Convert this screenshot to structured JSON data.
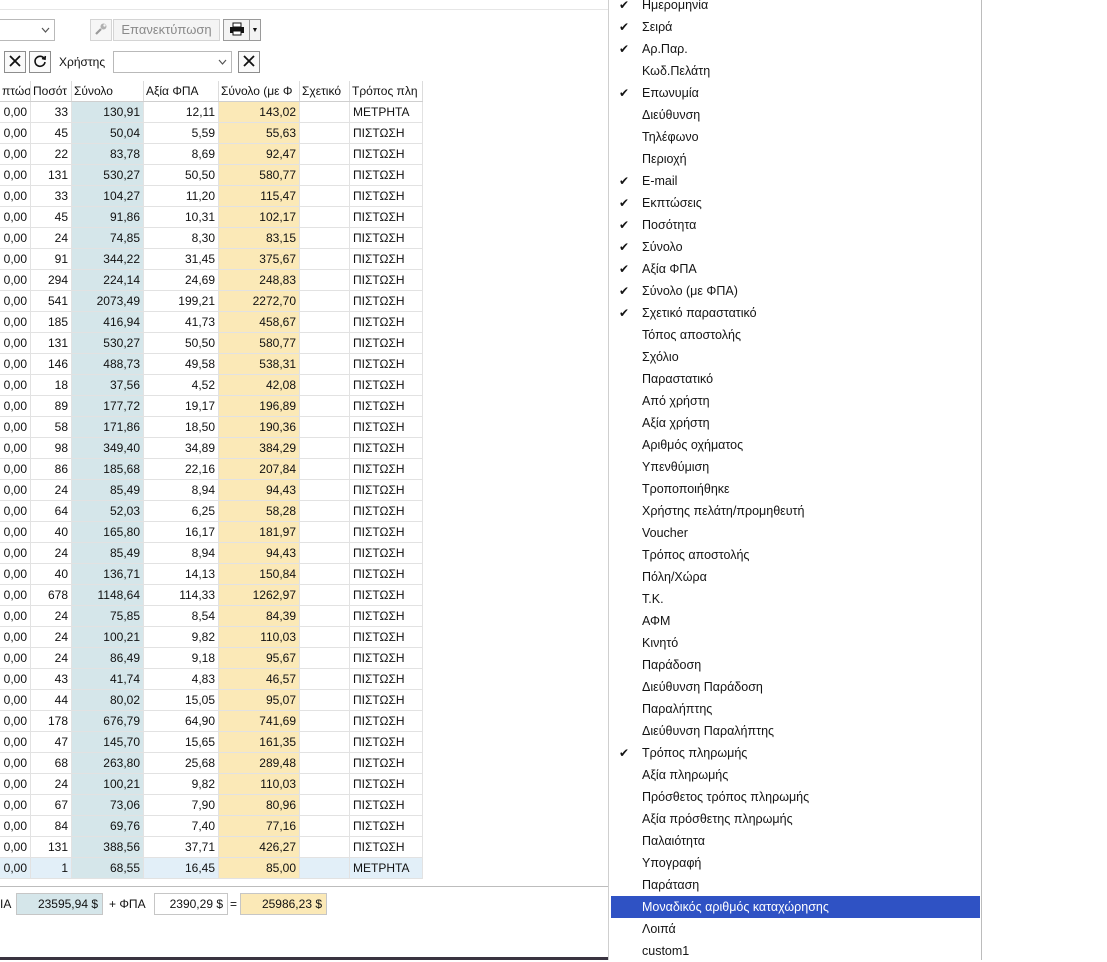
{
  "toolbar": {
    "reprint_label": "Επανεκτύπωση",
    "user_label": "Χρήστης",
    "user_value": ""
  },
  "grid": {
    "columns": [
      "πτώσ",
      "Ποσότ",
      "Σύνολο",
      "Αξία ΦΠΑ",
      "Σύνολο (με Φ",
      "Σχετικό",
      "Τρόπος πλη"
    ],
    "rows": [
      [
        "0,00",
        "33",
        "130,91",
        "12,11",
        "143,02",
        "",
        "ΜΕΤΡΗΤΑ"
      ],
      [
        "0,00",
        "45",
        "50,04",
        "5,59",
        "55,63",
        "",
        "ΠΙΣΤΩΣΗ"
      ],
      [
        "0,00",
        "22",
        "83,78",
        "8,69",
        "92,47",
        "",
        "ΠΙΣΤΩΣΗ"
      ],
      [
        "0,00",
        "131",
        "530,27",
        "50,50",
        "580,77",
        "",
        "ΠΙΣΤΩΣΗ"
      ],
      [
        "0,00",
        "33",
        "104,27",
        "11,20",
        "115,47",
        "",
        "ΠΙΣΤΩΣΗ"
      ],
      [
        "0,00",
        "45",
        "91,86",
        "10,31",
        "102,17",
        "",
        "ΠΙΣΤΩΣΗ"
      ],
      [
        "0,00",
        "24",
        "74,85",
        "8,30",
        "83,15",
        "",
        "ΠΙΣΤΩΣΗ"
      ],
      [
        "0,00",
        "91",
        "344,22",
        "31,45",
        "375,67",
        "",
        "ΠΙΣΤΩΣΗ"
      ],
      [
        "0,00",
        "294",
        "224,14",
        "24,69",
        "248,83",
        "",
        "ΠΙΣΤΩΣΗ"
      ],
      [
        "0,00",
        "541",
        "2073,49",
        "199,21",
        "2272,70",
        "",
        "ΠΙΣΤΩΣΗ"
      ],
      [
        "0,00",
        "185",
        "416,94",
        "41,73",
        "458,67",
        "",
        "ΠΙΣΤΩΣΗ"
      ],
      [
        "0,00",
        "131",
        "530,27",
        "50,50",
        "580,77",
        "",
        "ΠΙΣΤΩΣΗ"
      ],
      [
        "0,00",
        "146",
        "488,73",
        "49,58",
        "538,31",
        "",
        "ΠΙΣΤΩΣΗ"
      ],
      [
        "0,00",
        "18",
        "37,56",
        "4,52",
        "42,08",
        "",
        "ΠΙΣΤΩΣΗ"
      ],
      [
        "0,00",
        "89",
        "177,72",
        "19,17",
        "196,89",
        "",
        "ΠΙΣΤΩΣΗ"
      ],
      [
        "0,00",
        "58",
        "171,86",
        "18,50",
        "190,36",
        "",
        "ΠΙΣΤΩΣΗ"
      ],
      [
        "0,00",
        "98",
        "349,40",
        "34,89",
        "384,29",
        "",
        "ΠΙΣΤΩΣΗ"
      ],
      [
        "0,00",
        "86",
        "185,68",
        "22,16",
        "207,84",
        "",
        "ΠΙΣΤΩΣΗ"
      ],
      [
        "0,00",
        "24",
        "85,49",
        "8,94",
        "94,43",
        "",
        "ΠΙΣΤΩΣΗ"
      ],
      [
        "0,00",
        "64",
        "52,03",
        "6,25",
        "58,28",
        "",
        "ΠΙΣΤΩΣΗ"
      ],
      [
        "0,00",
        "40",
        "165,80",
        "16,17",
        "181,97",
        "",
        "ΠΙΣΤΩΣΗ"
      ],
      [
        "0,00",
        "24",
        "85,49",
        "8,94",
        "94,43",
        "",
        "ΠΙΣΤΩΣΗ"
      ],
      [
        "0,00",
        "40",
        "136,71",
        "14,13",
        "150,84",
        "",
        "ΠΙΣΤΩΣΗ"
      ],
      [
        "0,00",
        "678",
        "1148,64",
        "114,33",
        "1262,97",
        "",
        "ΠΙΣΤΩΣΗ"
      ],
      [
        "0,00",
        "24",
        "75,85",
        "8,54",
        "84,39",
        "",
        "ΠΙΣΤΩΣΗ"
      ],
      [
        "0,00",
        "24",
        "100,21",
        "9,82",
        "110,03",
        "",
        "ΠΙΣΤΩΣΗ"
      ],
      [
        "0,00",
        "24",
        "86,49",
        "9,18",
        "95,67",
        "",
        "ΠΙΣΤΩΣΗ"
      ],
      [
        "0,00",
        "43",
        "41,74",
        "4,83",
        "46,57",
        "",
        "ΠΙΣΤΩΣΗ"
      ],
      [
        "0,00",
        "44",
        "80,02",
        "15,05",
        "95,07",
        "",
        "ΠΙΣΤΩΣΗ"
      ],
      [
        "0,00",
        "178",
        "676,79",
        "64,90",
        "741,69",
        "",
        "ΠΙΣΤΩΣΗ"
      ],
      [
        "0,00",
        "47",
        "145,70",
        "15,65",
        "161,35",
        "",
        "ΠΙΣΤΩΣΗ"
      ],
      [
        "0,00",
        "68",
        "263,80",
        "25,68",
        "289,48",
        "",
        "ΠΙΣΤΩΣΗ"
      ],
      [
        "0,00",
        "24",
        "100,21",
        "9,82",
        "110,03",
        "",
        "ΠΙΣΤΩΣΗ"
      ],
      [
        "0,00",
        "67",
        "73,06",
        "7,90",
        "80,96",
        "",
        "ΠΙΣΤΩΣΗ"
      ],
      [
        "0,00",
        "84",
        "69,76",
        "7,40",
        "77,16",
        "",
        "ΠΙΣΤΩΣΗ"
      ],
      [
        "0,00",
        "131",
        "388,56",
        "37,71",
        "426,27",
        "",
        "ΠΙΣΤΩΣΗ"
      ],
      [
        "0,00",
        "1",
        "68,55",
        "16,45",
        "85,00",
        "",
        "ΜΕΤΡΗΤΑ"
      ]
    ],
    "selected_row": 36
  },
  "footer": {
    "label_prefix": "ΙΑ",
    "net_total": "23595,94 $",
    "plus_vat_label": "+ ΦΠΑ",
    "vat_total": "2390,29 $",
    "equals_label": "=",
    "gross_total": "25986,23 $"
  },
  "menu": {
    "items": [
      {
        "label": "Ημερομηνία",
        "checked": true
      },
      {
        "label": "Σειρά",
        "checked": true
      },
      {
        "label": "Αρ.Παρ.",
        "checked": true
      },
      {
        "label": "Κωδ.Πελάτη",
        "checked": false
      },
      {
        "label": "Επωνυμία",
        "checked": true
      },
      {
        "label": "Διεύθυνση",
        "checked": false
      },
      {
        "label": "Τηλέφωνο",
        "checked": false
      },
      {
        "label": "Περιοχή",
        "checked": false
      },
      {
        "label": "E-mail",
        "checked": true
      },
      {
        "label": "Εκπτώσεις",
        "checked": true
      },
      {
        "label": "Ποσότητα",
        "checked": true
      },
      {
        "label": "Σύνολο",
        "checked": true
      },
      {
        "label": "Αξία ΦΠΑ",
        "checked": true
      },
      {
        "label": "Σύνολο (με ΦΠΑ)",
        "checked": true
      },
      {
        "label": "Σχετικό παραστατικό",
        "checked": true
      },
      {
        "label": "Τόπος αποστολής",
        "checked": false
      },
      {
        "label": "Σχόλιο",
        "checked": false
      },
      {
        "label": "Παραστατικό",
        "checked": false
      },
      {
        "label": "Από χρήστη",
        "checked": false
      },
      {
        "label": "Αξία χρήστη",
        "checked": false
      },
      {
        "label": "Αριθμός οχήματος",
        "checked": false
      },
      {
        "label": "Υπενθύμιση",
        "checked": false
      },
      {
        "label": "Τροποποιήθηκε",
        "checked": false
      },
      {
        "label": "Χρήστης πελάτη/προμηθευτή",
        "checked": false
      },
      {
        "label": "Voucher",
        "checked": false
      },
      {
        "label": "Τρόπος αποστολής",
        "checked": false
      },
      {
        "label": "Πόλη/Χώρα",
        "checked": false
      },
      {
        "label": "Τ.Κ.",
        "checked": false
      },
      {
        "label": "ΑΦΜ",
        "checked": false
      },
      {
        "label": "Κινητό",
        "checked": false
      },
      {
        "label": "Παράδοση",
        "checked": false
      },
      {
        "label": "Διεύθυνση Παράδοση",
        "checked": false
      },
      {
        "label": "Παραλήπτης",
        "checked": false
      },
      {
        "label": "Διεύθυνση Παραλήπτης",
        "checked": false
      },
      {
        "label": "Τρόπος πληρωμής",
        "checked": true
      },
      {
        "label": "Αξία πληρωμής",
        "checked": false
      },
      {
        "label": "Πρόσθετος τρόπος πληρωμής",
        "checked": false
      },
      {
        "label": "Αξία πρόσθετης πληρωμής",
        "checked": false
      },
      {
        "label": "Παλαιότητα",
        "checked": false
      },
      {
        "label": "Υπογραφή",
        "checked": false
      },
      {
        "label": "Παράταση",
        "checked": false
      },
      {
        "label": "Μοναδικός αριθμός καταχώρησης",
        "checked": false
      },
      {
        "label": "Λοιπά",
        "checked": false
      },
      {
        "label": "custom1",
        "checked": false
      }
    ],
    "highlighted_index": 41,
    "check_glyph": "✔"
  },
  "colors": {
    "total_column_bg": "#d5e6ea",
    "gross_column_bg": "#fbe9b7",
    "menu_highlight": "#2f52c4",
    "selected_row_bg": "#e2eff8"
  }
}
